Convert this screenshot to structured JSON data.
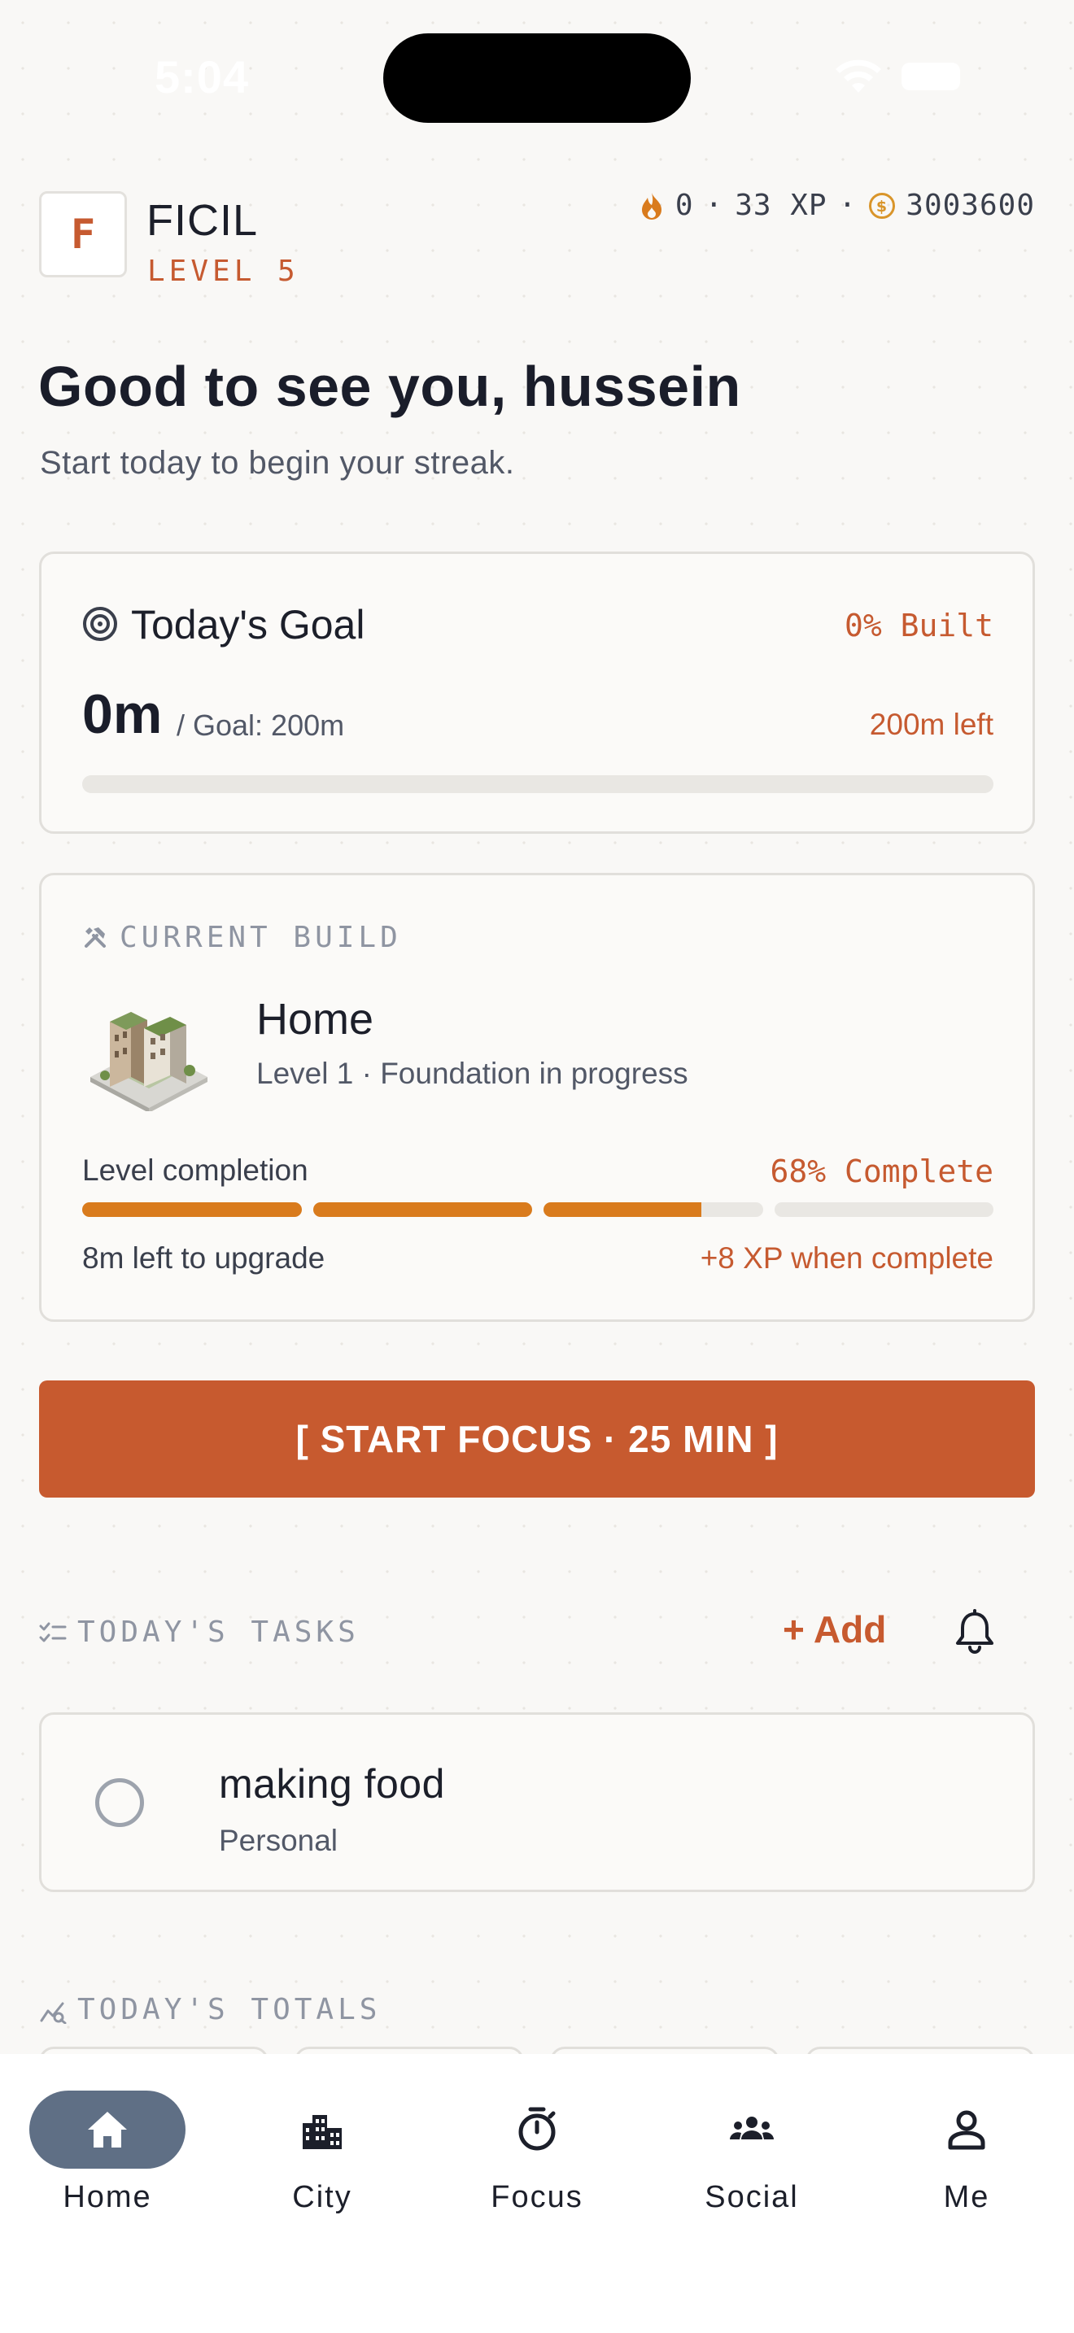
{
  "status_bar": {
    "time": "5:04"
  },
  "header": {
    "logo_letter": "F",
    "app_name": "FICIL",
    "level": "LEVEL 5",
    "streak": "0",
    "xp": "33 XP",
    "coins": "3003600",
    "separator": "·"
  },
  "greeting": {
    "title": "Good to see you, hussein",
    "subtitle": "Start today to begin your streak."
  },
  "goal": {
    "title": "Today's Goal",
    "percent_label": "0% Built",
    "value": "0m",
    "target": "/ Goal: 200m",
    "remaining": "200m left",
    "progress_fraction": 0
  },
  "current_build": {
    "label": "CURRENT BUILD",
    "name": "Home",
    "subtitle": "Level 1 · Foundation in progress",
    "completion_label": "Level completion",
    "completion_percent": "68% Complete",
    "segments": [
      1,
      1,
      0.72,
      0
    ],
    "time_left": "8m left to upgrade",
    "xp_reward": "+8 XP when complete"
  },
  "start_button": {
    "label": "[ START FOCUS · 25 MIN ]"
  },
  "tasks": {
    "label": "TODAY'S TASKS",
    "add_label": "+ Add",
    "items": [
      {
        "title": "making food",
        "category": "Personal",
        "done": false
      }
    ]
  },
  "totals": {
    "label": "TODAY'S TOTALS"
  },
  "tab_bar": {
    "tabs": [
      {
        "label": "Home",
        "icon": "home-icon",
        "active": true
      },
      {
        "label": "City",
        "icon": "city-icon",
        "active": false
      },
      {
        "label": "Focus",
        "icon": "stopwatch-icon",
        "active": false
      },
      {
        "label": "Social",
        "icon": "people-icon",
        "active": false
      },
      {
        "label": "Me",
        "icon": "person-icon",
        "active": false
      }
    ]
  },
  "colors": {
    "accent": "#c75a2f",
    "progress": "#d97b1d",
    "tab_active": "#5f6f85",
    "background": "#f9f8f6"
  }
}
